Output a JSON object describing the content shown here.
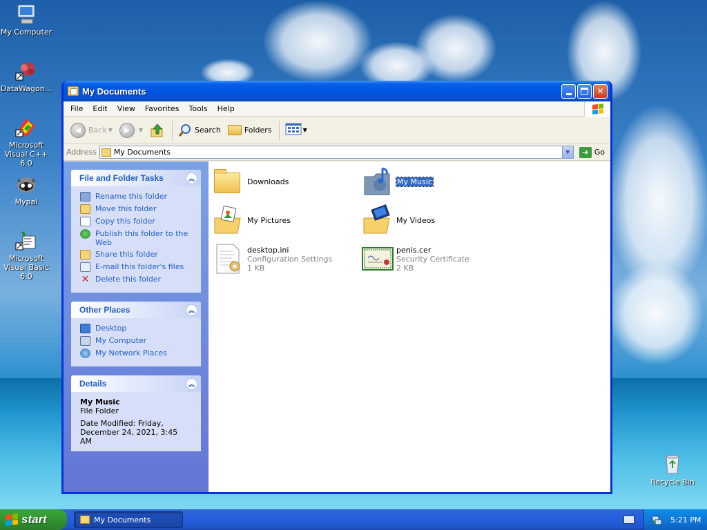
{
  "desktop": {
    "icons": [
      {
        "label": "My Computer"
      },
      {
        "label": "DataWagon..."
      },
      {
        "label": "Microsoft Visual C++ 6.0"
      },
      {
        "label": "Mypal"
      },
      {
        "label": "Microsoft Visual Basic 6.0"
      },
      {
        "label": "Recycle Bin"
      }
    ]
  },
  "window": {
    "title": "My Documents",
    "menu": [
      "File",
      "Edit",
      "View",
      "Favorites",
      "Tools",
      "Help"
    ],
    "toolbar": {
      "back": "Back",
      "search": "Search",
      "folders": "Folders"
    },
    "address": {
      "label": "Address",
      "value": "My Documents",
      "go": "Go"
    }
  },
  "taskpane": {
    "file_tasks": {
      "title": "File and Folder Tasks",
      "items": [
        "Rename this folder",
        "Move this folder",
        "Copy this folder",
        "Publish this folder to the Web",
        "Share this folder",
        "E-mail this folder's files",
        "Delete this folder"
      ]
    },
    "other_places": {
      "title": "Other Places",
      "items": [
        "Desktop",
        "My Computer",
        "My Network Places"
      ]
    },
    "details": {
      "title": "Details",
      "name": "My Music",
      "type": "File Folder",
      "modified": "Date Modified: Friday, December 24, 2021, 3:45 AM"
    }
  },
  "files": [
    {
      "name": "Downloads",
      "type": "",
      "size": ""
    },
    {
      "name": "My Music",
      "type": "",
      "size": "",
      "selected": true
    },
    {
      "name": "My Pictures",
      "type": "",
      "size": ""
    },
    {
      "name": "My Videos",
      "type": "",
      "size": ""
    },
    {
      "name": "desktop.ini",
      "type": "Configuration Settings",
      "size": "1 KB"
    },
    {
      "name": "penis.cer",
      "type": "Security Certificate",
      "size": "2 KB"
    }
  ],
  "taskbar": {
    "start": "start",
    "task": "My Documents",
    "clock": "5:21 PM"
  },
  "colors": {
    "link": "#215dc6",
    "selection": "#316ac5",
    "titlebar": "#0054e3",
    "start_green": "#36a336"
  }
}
